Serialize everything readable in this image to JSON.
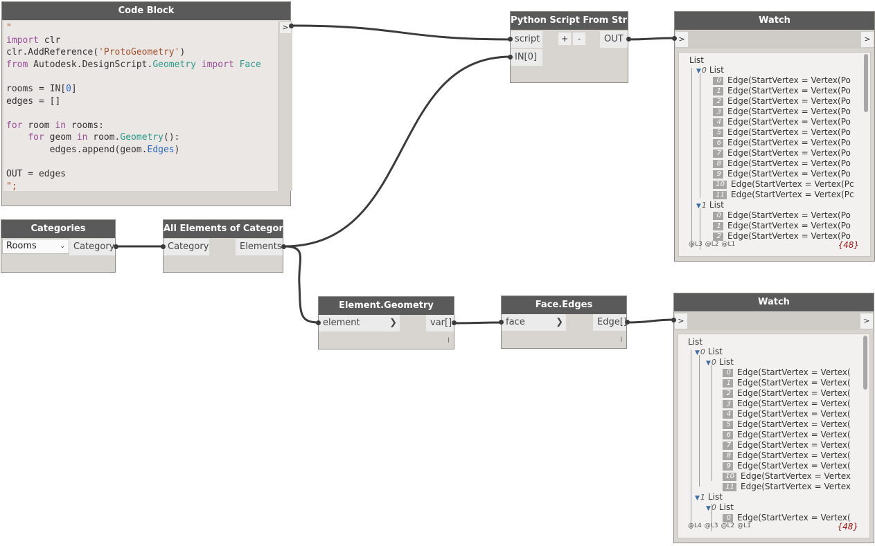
{
  "code_block": {
    "title": "Code Block",
    "output_marker": ">",
    "lines": [
      [
        {
          "t": "\"",
          "c": "str"
        }
      ],
      [
        {
          "t": "import",
          "c": "kw"
        },
        {
          "t": " clr",
          "c": ""
        }
      ],
      [
        {
          "t": "clr.AddReference(",
          "c": ""
        },
        {
          "t": "'ProtoGeometry'",
          "c": "str"
        },
        {
          "t": ")",
          "c": ""
        }
      ],
      [
        {
          "t": "from",
          "c": "kw"
        },
        {
          "t": " Autodesk.DesignScript.",
          "c": ""
        },
        {
          "t": "Geometry",
          "c": "typ"
        },
        {
          "t": " ",
          "c": ""
        },
        {
          "t": "import",
          "c": "kw"
        },
        {
          "t": " ",
          "c": ""
        },
        {
          "t": "Face",
          "c": "typ"
        }
      ],
      [],
      [
        {
          "t": "rooms = IN[",
          "c": ""
        },
        {
          "t": "0",
          "c": "num"
        },
        {
          "t": "]",
          "c": ""
        }
      ],
      [
        {
          "t": "edges = []",
          "c": ""
        }
      ],
      [],
      [
        {
          "t": "for",
          "c": "kw"
        },
        {
          "t": " room ",
          "c": ""
        },
        {
          "t": "in",
          "c": "kw"
        },
        {
          "t": " rooms:",
          "c": ""
        }
      ],
      [
        {
          "t": "    ",
          "c": ""
        },
        {
          "t": "for",
          "c": "kw"
        },
        {
          "t": " geom ",
          "c": ""
        },
        {
          "t": "in",
          "c": "kw"
        },
        {
          "t": " room.",
          "c": ""
        },
        {
          "t": "Geometry",
          "c": "typ"
        },
        {
          "t": "():",
          "c": ""
        }
      ],
      [
        {
          "t": "        edges.append(geom.",
          "c": ""
        },
        {
          "t": "Edges",
          "c": "num"
        },
        {
          "t": ")",
          "c": ""
        }
      ],
      [],
      [
        {
          "t": "OUT = edges",
          "c": ""
        }
      ],
      [
        {
          "t": "\";",
          "c": "str"
        }
      ]
    ]
  },
  "python_node": {
    "title": "Python Script From String",
    "in_script": "script",
    "in_0": "IN[0]",
    "add_label": "+",
    "remove_label": "-",
    "out_label": "OUT"
  },
  "categories_node": {
    "title": "Categories",
    "selected": "Rooms",
    "out_label": "Category"
  },
  "all_elements_node": {
    "title": "All Elements of Category",
    "in_label": "Category",
    "out_label": "Elements"
  },
  "element_geometry_node": {
    "title": "Element.Geometry",
    "in_label": "element",
    "out_label": "var[]",
    "lacing": "l"
  },
  "face_edges_node": {
    "title": "Face.Edges",
    "in_label": "face",
    "out_label": "Edge[]",
    "lacing": "l"
  },
  "watch1": {
    "title": "Watch",
    "in_marker": ">",
    "out_marker": ">",
    "root": "List",
    "rows": [
      {
        "kind": "list",
        "label": "List",
        "index": "0"
      },
      {
        "kind": "item",
        "index": "0",
        "text": "Edge(StartVertex = Vertex(Po"
      },
      {
        "kind": "item",
        "index": "1",
        "text": "Edge(StartVertex = Vertex(Po"
      },
      {
        "kind": "item",
        "index": "2",
        "text": "Edge(StartVertex = Vertex(Po"
      },
      {
        "kind": "item",
        "index": "3",
        "text": "Edge(StartVertex = Vertex(Po"
      },
      {
        "kind": "item",
        "index": "4",
        "text": "Edge(StartVertex = Vertex(Po"
      },
      {
        "kind": "item",
        "index": "5",
        "text": "Edge(StartVertex = Vertex(Po"
      },
      {
        "kind": "item",
        "index": "6",
        "text": "Edge(StartVertex = Vertex(Po"
      },
      {
        "kind": "item",
        "index": "7",
        "text": "Edge(StartVertex = Vertex(Po"
      },
      {
        "kind": "item",
        "index": "8",
        "text": "Edge(StartVertex = Vertex(Po"
      },
      {
        "kind": "item",
        "index": "9",
        "text": "Edge(StartVertex = Vertex(Po"
      },
      {
        "kind": "item",
        "index": "10",
        "text": "Edge(StartVertex = Vertex(Pc"
      },
      {
        "kind": "item",
        "index": "11",
        "text": "Edge(StartVertex = Vertex(Pc"
      },
      {
        "kind": "list",
        "label": "List",
        "index": "1"
      },
      {
        "kind": "item",
        "index": "0",
        "text": "Edge(StartVertex = Vertex(Po"
      },
      {
        "kind": "item",
        "index": "1",
        "text": "Edge(StartVertex = Vertex(Po"
      },
      {
        "kind": "item",
        "index": "2",
        "text": "Edge(StartVertex = Vertex(Po"
      }
    ],
    "levels": [
      "@L3",
      "@L2",
      "@L1"
    ],
    "count": "{48}"
  },
  "watch2": {
    "title": "Watch",
    "in_marker": ">",
    "out_marker": ">",
    "root": "List",
    "rows": [
      {
        "kind": "list",
        "label": "List",
        "index": "0",
        "depth": 1
      },
      {
        "kind": "list",
        "label": "List",
        "index": "0",
        "depth": 2
      },
      {
        "kind": "item",
        "index": "0",
        "text": "Edge(StartVertex = Vertex(",
        "depth": 2
      },
      {
        "kind": "item",
        "index": "1",
        "text": "Edge(StartVertex = Vertex(",
        "depth": 2
      },
      {
        "kind": "item",
        "index": "2",
        "text": "Edge(StartVertex = Vertex(",
        "depth": 2
      },
      {
        "kind": "item",
        "index": "3",
        "text": "Edge(StartVertex = Vertex(",
        "depth": 2
      },
      {
        "kind": "item",
        "index": "4",
        "text": "Edge(StartVertex = Vertex(",
        "depth": 2
      },
      {
        "kind": "item",
        "index": "5",
        "text": "Edge(StartVertex = Vertex(",
        "depth": 2
      },
      {
        "kind": "item",
        "index": "6",
        "text": "Edge(StartVertex = Vertex(",
        "depth": 2
      },
      {
        "kind": "item",
        "index": "7",
        "text": "Edge(StartVertex = Vertex(",
        "depth": 2
      },
      {
        "kind": "item",
        "index": "8",
        "text": "Edge(StartVertex = Vertex(",
        "depth": 2
      },
      {
        "kind": "item",
        "index": "9",
        "text": "Edge(StartVertex = Vertex(",
        "depth": 2
      },
      {
        "kind": "item",
        "index": "10",
        "text": "Edge(StartVertex = Vertex",
        "depth": 2
      },
      {
        "kind": "item",
        "index": "11",
        "text": "Edge(StartVertex = Vertex",
        "depth": 2
      },
      {
        "kind": "list",
        "label": "List",
        "index": "1",
        "depth": 1
      },
      {
        "kind": "list",
        "label": "List",
        "index": "0",
        "depth": 2
      },
      {
        "kind": "item",
        "index": "0",
        "text": "Edge(StartVertex = Vertex(",
        "depth": 2
      }
    ],
    "levels": [
      "@L4",
      "@L3",
      "@L2",
      "@L1"
    ],
    "count": "{48}"
  },
  "colors": {
    "canvas": "#ffffff",
    "node_body": "#d8d5d0",
    "node_header": "#5a5a5a",
    "wire": "#3b3b3b",
    "count": "#a01616"
  }
}
